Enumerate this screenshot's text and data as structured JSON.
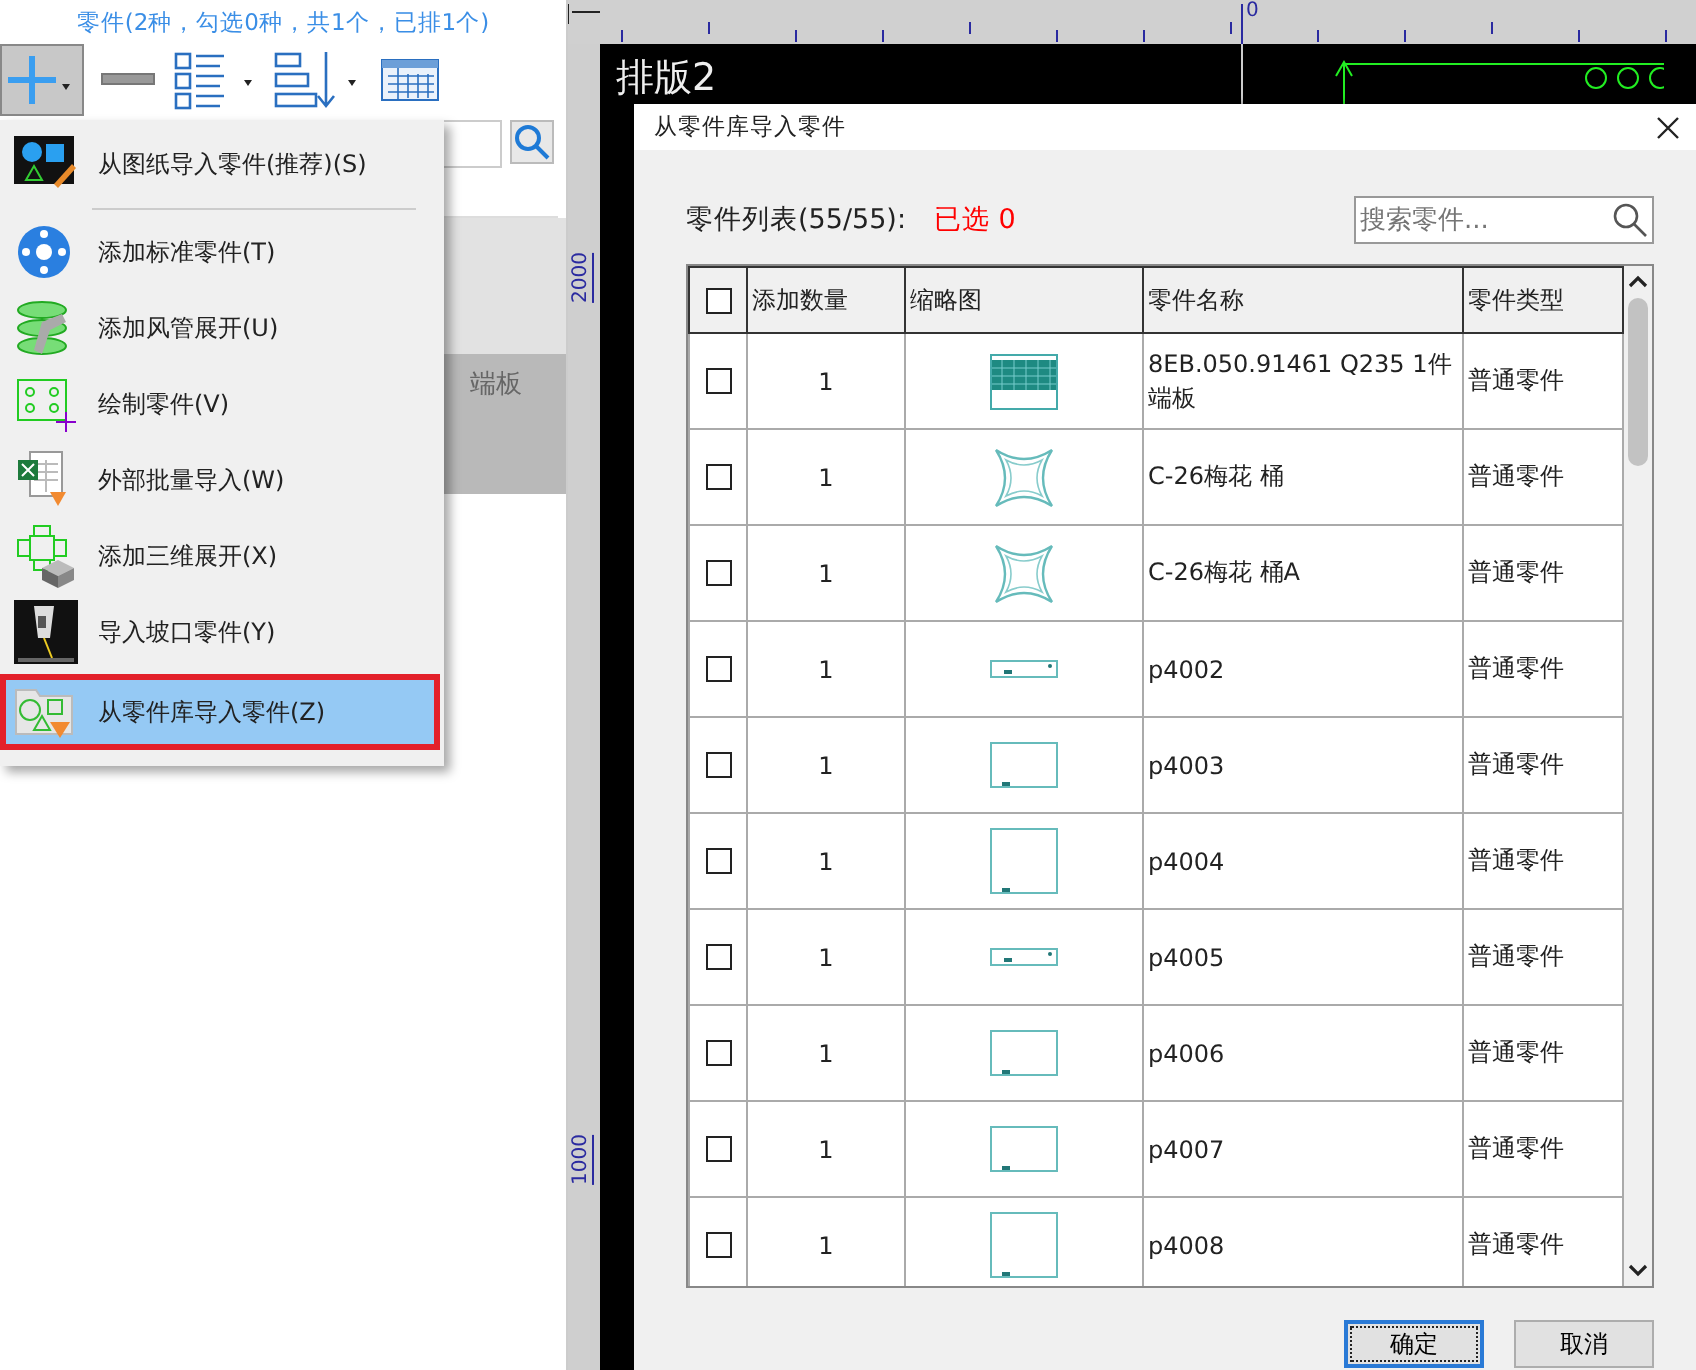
{
  "panel": {
    "header": "零件(2种，勾选0种，共1个，已排1个)",
    "row_text": "端板"
  },
  "menu": {
    "items": [
      {
        "kind": "drawing",
        "label": "从图纸导入零件(推荐)(S)",
        "selected": false
      },
      {
        "kind": "standard",
        "label": "添加标准零件(T)",
        "selected": false
      },
      {
        "kind": "duct",
        "label": "添加风管展开(U)",
        "selected": false
      },
      {
        "kind": "sketch",
        "label": "绘制零件(V)",
        "selected": false
      },
      {
        "kind": "excel",
        "label": "外部批量导入(W)",
        "selected": false
      },
      {
        "kind": "solid",
        "label": "添加三维展开(X)",
        "selected": false
      },
      {
        "kind": "bevel",
        "label": "导入坡口零件(Y)",
        "selected": false
      },
      {
        "kind": "library",
        "label": "从零件库导入零件(Z)",
        "selected": true
      }
    ]
  },
  "rulers": {
    "top_label": "0",
    "left_labels": [
      "2000",
      "1000"
    ]
  },
  "canvas": {
    "title": "排版2"
  },
  "dialog": {
    "title": "从零件库导入零件",
    "list_label": "零件列表(55/55):",
    "selected_count": "已选 0",
    "search": {
      "placeholder": "搜索零件..."
    },
    "table": {
      "header_checked": false,
      "columns": [
        "添加数量",
        "缩略图",
        "零件名称",
        "零件类型"
      ],
      "rows": [
        {
          "checked": false,
          "quantity": "1",
          "kind": "mesh",
          "name": "8EB.050.91461 Q235 1件端板",
          "type": "普通零件"
        },
        {
          "checked": false,
          "quantity": "1",
          "kind": "star",
          "name": "C-26梅花 桶",
          "type": "普通零件"
        },
        {
          "checked": false,
          "quantity": "1",
          "kind": "star",
          "name": "C-26梅花 桶A",
          "type": "普通零件"
        },
        {
          "checked": false,
          "quantity": "1",
          "kind": "strip",
          "name": "p4002",
          "type": "普通零件"
        },
        {
          "checked": false,
          "quantity": "1",
          "kind": "box",
          "name": "p4003",
          "type": "普通零件"
        },
        {
          "checked": false,
          "quantity": "1",
          "kind": "tall",
          "name": "p4004",
          "type": "普通零件"
        },
        {
          "checked": false,
          "quantity": "1",
          "kind": "strip",
          "name": "p4005",
          "type": "普通零件"
        },
        {
          "checked": false,
          "quantity": "1",
          "kind": "box",
          "name": "p4006",
          "type": "普通零件"
        },
        {
          "checked": false,
          "quantity": "1",
          "kind": "box",
          "name": "p4007",
          "type": "普通零件"
        },
        {
          "checked": false,
          "quantity": "1",
          "kind": "tall",
          "name": "p4008",
          "type": "普通零件"
        }
      ]
    },
    "buttons": [
      {
        "label": "确定",
        "default": true
      },
      {
        "label": "取消",
        "default": false
      }
    ]
  }
}
